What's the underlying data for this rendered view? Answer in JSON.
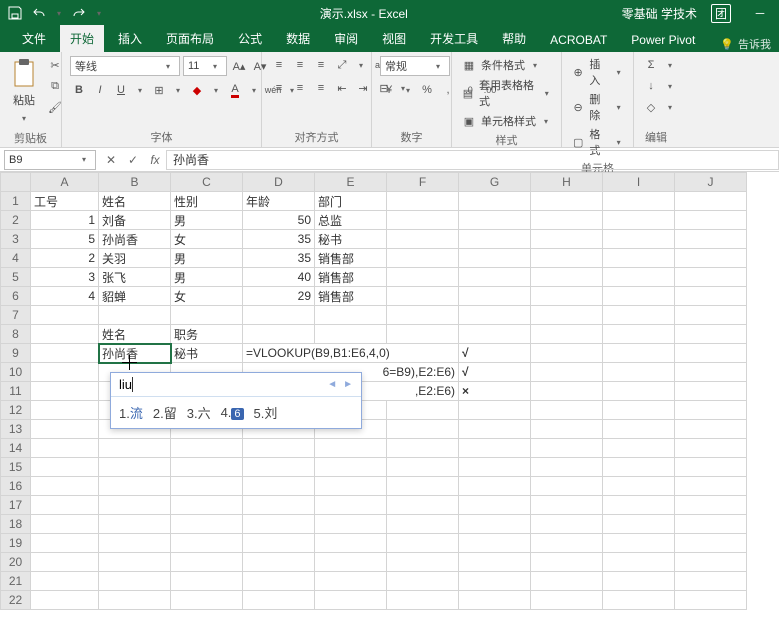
{
  "title": {
    "doc": "演示.xlsx",
    "app": "Excel",
    "sep": " - ",
    "brand": "零基础 学技术",
    "team": "团"
  },
  "tabs": {
    "file": "文件",
    "home": "开始",
    "insert": "插入",
    "layout": "页面布局",
    "formulas": "公式",
    "data": "数据",
    "review": "审阅",
    "view": "视图",
    "dev": "开发工具",
    "help": "帮助",
    "acrobat": "ACROBAT",
    "pivot": "Power Pivot",
    "tell": "告诉我"
  },
  "ribbon": {
    "clipboard": {
      "label": "剪贴板",
      "paste": "粘贴"
    },
    "font": {
      "label": "字体",
      "name": "等线",
      "size": "11",
      "bold": "B",
      "italic": "I",
      "underline": "U",
      "wen": "wén"
    },
    "align": {
      "label": "对齐方式"
    },
    "number": {
      "label": "数字",
      "format": "常规"
    },
    "styles": {
      "label": "样式",
      "cond": "条件格式",
      "table": "套用表格格式",
      "cell": "单元格样式"
    },
    "cells": {
      "label": "单元格",
      "insert": "插入",
      "delete": "删除",
      "format": "格式"
    },
    "editing": {
      "label": "编辑"
    }
  },
  "namebox": "B9",
  "formula": "孙尚香",
  "cols": [
    "A",
    "B",
    "C",
    "D",
    "E",
    "F",
    "G",
    "H",
    "I",
    "J"
  ],
  "headers": {
    "A": "工号",
    "B": "姓名",
    "C": "性别",
    "D": "年龄",
    "E": "部门"
  },
  "rows": [
    {
      "A": "1",
      "B": "刘备",
      "C": "男",
      "D": "50",
      "E": "总监"
    },
    {
      "A": "5",
      "B": "孙尚香",
      "C": "女",
      "D": "35",
      "E": "秘书"
    },
    {
      "A": "2",
      "B": "关羽",
      "C": "男",
      "D": "35",
      "E": "销售部"
    },
    {
      "A": "3",
      "B": "张飞",
      "C": "男",
      "D": "40",
      "E": "销售部"
    },
    {
      "A": "4",
      "B": "貂蝉",
      "C": "女",
      "D": "29",
      "E": "销售部"
    }
  ],
  "lookup": {
    "h1": "姓名",
    "h2": "职务",
    "b9": "孙尚香",
    "c9": "秘书",
    "d9": "=VLOOKUP(B9,B1:E6,4,0)",
    "g9": "√",
    "d10": "6=B9),E2:E6)",
    "g10": "√",
    "d11": ",E2:E6)",
    "g11": "×"
  },
  "ime": {
    "input": "liu",
    "c1n": "1.",
    "c1": "流",
    "c2n": "2.",
    "c2": "留",
    "c3n": "3.",
    "c3": "六",
    "c4n": "4.",
    "c4": "6",
    "c5n": "5.",
    "c5": "刘"
  }
}
